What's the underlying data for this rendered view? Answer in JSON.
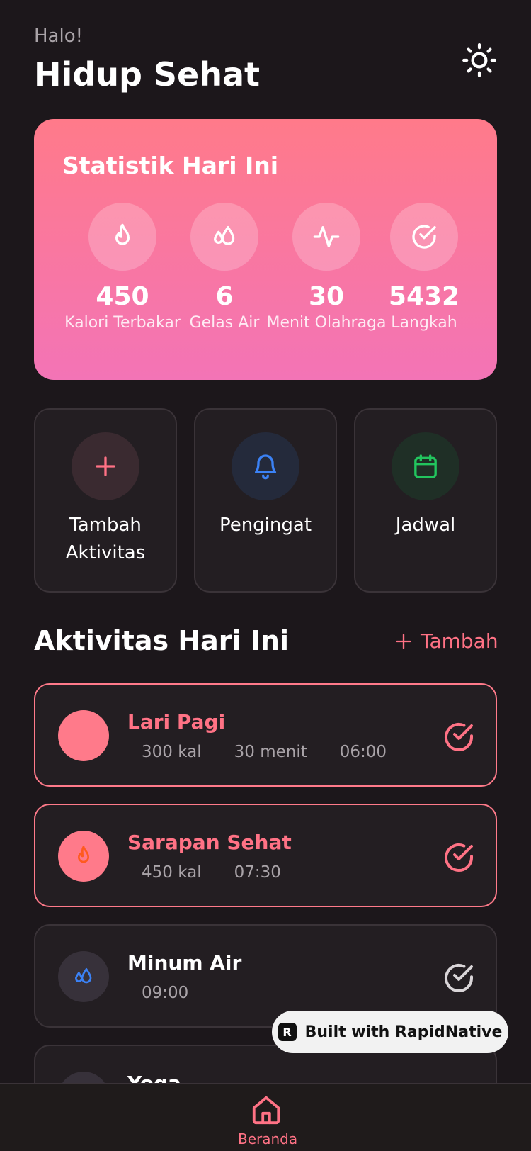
{
  "header": {
    "greeting": "Halo!",
    "title": "Hidup Sehat",
    "theme_icon": "sun-icon"
  },
  "stats": {
    "title": "Statistik Hari Ini",
    "items": [
      {
        "value": "450",
        "label": "Kalori Terbakar",
        "icon": "flame-icon"
      },
      {
        "value": "6",
        "label": "Gelas Air",
        "icon": "droplets-icon"
      },
      {
        "value": "30",
        "label": "Menit Olahraga",
        "icon": "activity-icon"
      },
      {
        "value": "5432",
        "label": "Langkah",
        "icon": "check-circle-icon"
      }
    ]
  },
  "quick_actions": [
    {
      "label": "Tambah Aktivitas",
      "icon": "plus-icon",
      "color": "#ff7285"
    },
    {
      "label": "Pengingat",
      "icon": "bell-icon",
      "color": "#3b82f6"
    },
    {
      "label": "Jadwal",
      "icon": "calendar-icon",
      "color": "#22c55e"
    }
  ],
  "activities_section": {
    "title": "Aktivitas Hari Ini",
    "add_label": "Tambah"
  },
  "activities": [
    {
      "name": "Lari Pagi",
      "meta": [
        "300 kal",
        "30 menit",
        "06:00"
      ],
      "done": true
    },
    {
      "name": "Sarapan Sehat",
      "meta": [
        "450 kal",
        "07:30"
      ],
      "done": true
    },
    {
      "name": "Minum Air",
      "meta": [
        "09:00"
      ],
      "done": false
    },
    {
      "name": "Yoga",
      "meta": [],
      "done": false
    }
  ],
  "badge": {
    "label": "Built with RapidNative"
  },
  "tabbar": {
    "home_label": "Beranda"
  },
  "colors": {
    "accent": "#ff7285",
    "background": "#1c171b",
    "card": "#231e22"
  }
}
